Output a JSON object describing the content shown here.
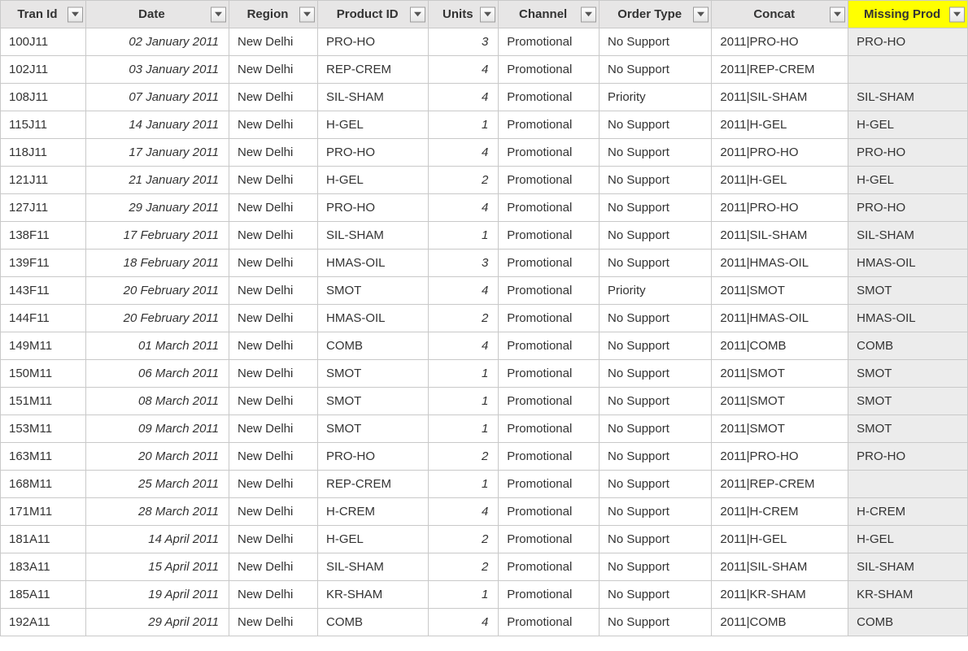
{
  "columns": [
    {
      "key": "tran_id",
      "label": "Tran Id",
      "highlight": false
    },
    {
      "key": "date",
      "label": "Date",
      "highlight": false
    },
    {
      "key": "region",
      "label": "Region",
      "highlight": false
    },
    {
      "key": "product_id",
      "label": "Product ID",
      "highlight": false
    },
    {
      "key": "units",
      "label": "Units",
      "highlight": false
    },
    {
      "key": "channel",
      "label": "Channel",
      "highlight": false
    },
    {
      "key": "order_type",
      "label": "Order Type",
      "highlight": false
    },
    {
      "key": "concat",
      "label": "Concat",
      "highlight": false
    },
    {
      "key": "missing_prod",
      "label": "Missing Prod",
      "highlight": true
    }
  ],
  "rows": [
    {
      "tran_id": "100J11",
      "date": "02 January 2011",
      "region": "New Delhi",
      "product_id": "PRO-HO",
      "units": "3",
      "channel": "Promotional",
      "order_type": "No Support",
      "concat": "2011|PRO-HO",
      "missing_prod": "PRO-HO"
    },
    {
      "tran_id": "102J11",
      "date": "03 January 2011",
      "region": "New Delhi",
      "product_id": "REP-CREM",
      "units": "4",
      "channel": "Promotional",
      "order_type": "No Support",
      "concat": "2011|REP-CREM",
      "missing_prod": ""
    },
    {
      "tran_id": "108J11",
      "date": "07 January 2011",
      "region": "New Delhi",
      "product_id": "SIL-SHAM",
      "units": "4",
      "channel": "Promotional",
      "order_type": "Priority",
      "concat": "2011|SIL-SHAM",
      "missing_prod": "SIL-SHAM"
    },
    {
      "tran_id": "115J11",
      "date": "14 January 2011",
      "region": "New Delhi",
      "product_id": "H-GEL",
      "units": "1",
      "channel": "Promotional",
      "order_type": "No Support",
      "concat": "2011|H-GEL",
      "missing_prod": "H-GEL"
    },
    {
      "tran_id": "118J11",
      "date": "17 January 2011",
      "region": "New Delhi",
      "product_id": "PRO-HO",
      "units": "4",
      "channel": "Promotional",
      "order_type": "No Support",
      "concat": "2011|PRO-HO",
      "missing_prod": "PRO-HO"
    },
    {
      "tran_id": "121J11",
      "date": "21 January 2011",
      "region": "New Delhi",
      "product_id": "H-GEL",
      "units": "2",
      "channel": "Promotional",
      "order_type": "No Support",
      "concat": "2011|H-GEL",
      "missing_prod": "H-GEL"
    },
    {
      "tran_id": "127J11",
      "date": "29 January 2011",
      "region": "New Delhi",
      "product_id": "PRO-HO",
      "units": "4",
      "channel": "Promotional",
      "order_type": "No Support",
      "concat": "2011|PRO-HO",
      "missing_prod": "PRO-HO"
    },
    {
      "tran_id": "138F11",
      "date": "17 February 2011",
      "region": "New Delhi",
      "product_id": "SIL-SHAM",
      "units": "1",
      "channel": "Promotional",
      "order_type": "No Support",
      "concat": "2011|SIL-SHAM",
      "missing_prod": "SIL-SHAM"
    },
    {
      "tran_id": "139F11",
      "date": "18 February 2011",
      "region": "New Delhi",
      "product_id": "HMAS-OIL",
      "units": "3",
      "channel": "Promotional",
      "order_type": "No Support",
      "concat": "2011|HMAS-OIL",
      "missing_prod": "HMAS-OIL"
    },
    {
      "tran_id": "143F11",
      "date": "20 February 2011",
      "region": "New Delhi",
      "product_id": "SMOT",
      "units": "4",
      "channel": "Promotional",
      "order_type": "Priority",
      "concat": "2011|SMOT",
      "missing_prod": "SMOT"
    },
    {
      "tran_id": "144F11",
      "date": "20 February 2011",
      "region": "New Delhi",
      "product_id": "HMAS-OIL",
      "units": "2",
      "channel": "Promotional",
      "order_type": "No Support",
      "concat": "2011|HMAS-OIL",
      "missing_prod": "HMAS-OIL"
    },
    {
      "tran_id": "149M11",
      "date": "01 March 2011",
      "region": "New Delhi",
      "product_id": "COMB",
      "units": "4",
      "channel": "Promotional",
      "order_type": "No Support",
      "concat": "2011|COMB",
      "missing_prod": "COMB"
    },
    {
      "tran_id": "150M11",
      "date": "06 March 2011",
      "region": "New Delhi",
      "product_id": "SMOT",
      "units": "1",
      "channel": "Promotional",
      "order_type": "No Support",
      "concat": "2011|SMOT",
      "missing_prod": "SMOT"
    },
    {
      "tran_id": "151M11",
      "date": "08 March 2011",
      "region": "New Delhi",
      "product_id": "SMOT",
      "units": "1",
      "channel": "Promotional",
      "order_type": "No Support",
      "concat": "2011|SMOT",
      "missing_prod": "SMOT"
    },
    {
      "tran_id": "153M11",
      "date": "09 March 2011",
      "region": "New Delhi",
      "product_id": "SMOT",
      "units": "1",
      "channel": "Promotional",
      "order_type": "No Support",
      "concat": "2011|SMOT",
      "missing_prod": "SMOT"
    },
    {
      "tran_id": "163M11",
      "date": "20 March 2011",
      "region": "New Delhi",
      "product_id": "PRO-HO",
      "units": "2",
      "channel": "Promotional",
      "order_type": "No Support",
      "concat": "2011|PRO-HO",
      "missing_prod": "PRO-HO"
    },
    {
      "tran_id": "168M11",
      "date": "25 March 2011",
      "region": "New Delhi",
      "product_id": "REP-CREM",
      "units": "1",
      "channel": "Promotional",
      "order_type": "No Support",
      "concat": "2011|REP-CREM",
      "missing_prod": ""
    },
    {
      "tran_id": "171M11",
      "date": "28 March 2011",
      "region": "New Delhi",
      "product_id": "H-CREM",
      "units": "4",
      "channel": "Promotional",
      "order_type": "No Support",
      "concat": "2011|H-CREM",
      "missing_prod": "H-CREM"
    },
    {
      "tran_id": "181A11",
      "date": "14 April 2011",
      "region": "New Delhi",
      "product_id": "H-GEL",
      "units": "2",
      "channel": "Promotional",
      "order_type": "No Support",
      "concat": "2011|H-GEL",
      "missing_prod": "H-GEL"
    },
    {
      "tran_id": "183A11",
      "date": "15 April 2011",
      "region": "New Delhi",
      "product_id": "SIL-SHAM",
      "units": "2",
      "channel": "Promotional",
      "order_type": "No Support",
      "concat": "2011|SIL-SHAM",
      "missing_prod": "SIL-SHAM"
    },
    {
      "tran_id": "185A11",
      "date": "19 April 2011",
      "region": "New Delhi",
      "product_id": "KR-SHAM",
      "units": "1",
      "channel": "Promotional",
      "order_type": "No Support",
      "concat": "2011|KR-SHAM",
      "missing_prod": "KR-SHAM"
    },
    {
      "tran_id": "192A11",
      "date": "29 April 2011",
      "region": "New Delhi",
      "product_id": "COMB",
      "units": "4",
      "channel": "Promotional",
      "order_type": "No Support",
      "concat": "2011|COMB",
      "missing_prod": "COMB"
    }
  ]
}
